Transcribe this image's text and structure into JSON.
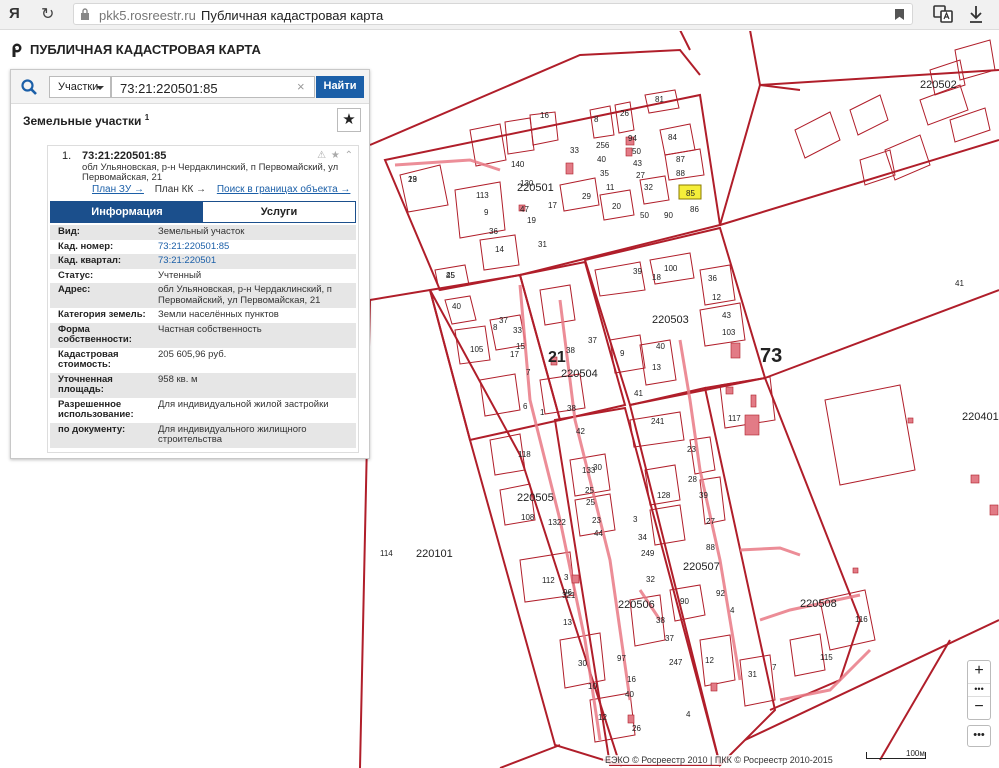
{
  "browser": {
    "logo": "Я",
    "domain": "pkk5.rosreestr.ru",
    "page_title": "Публичная кадастровая карта"
  },
  "app": {
    "title": "ПУБЛИЧНАЯ КАДАСТРОВАЯ КАРТА"
  },
  "search": {
    "type_label": "Участки",
    "query": "73:21:220501:85",
    "clear": "×",
    "find_label": "Найти"
  },
  "results": {
    "section_title": "Земельные участки",
    "count": "1",
    "item": {
      "num": "1.",
      "cad_number": "73:21:220501:85",
      "address_short": "обл Ульяновская, р-н Чердаклинский, п Первомайский, ул Первомайская, 21",
      "links": {
        "plan_zu": "План ЗУ →",
        "plan_kk": "План КК →",
        "search_bounds": "Поиск в границах объекта →"
      }
    },
    "tabs": {
      "info": "Информация",
      "services": "Услуги"
    },
    "properties": [
      {
        "k": "Вид:",
        "v": "Земельный участок",
        "link": false
      },
      {
        "k": "Кад. номер:",
        "v": "73:21:220501:85",
        "link": true
      },
      {
        "k": "Кад. квартал:",
        "v": "73:21:220501",
        "link": true
      },
      {
        "k": "Статус:",
        "v": "Учтенный",
        "link": false
      },
      {
        "k": "Адрес:",
        "v": "обл Ульяновская, р-н Чердаклинский, п Первомайский, ул Первомайская, 21",
        "link": false
      },
      {
        "k": "Категория земель:",
        "v": "Земли населённых пунктов",
        "link": false
      },
      {
        "k": "Форма собственности:",
        "v": "Частная собственность",
        "link": false
      },
      {
        "k": "Кадастровая стоимость:",
        "v": "205 605,96 руб.",
        "link": false
      },
      {
        "k": "Уточненная площадь:",
        "v": "958 кв. м",
        "link": false
      },
      {
        "k": "Разрешенное использование:",
        "v": "Для индивидуальной жилой застройки",
        "link": false
      },
      {
        "k": "по документу:",
        "v": "Для индивидуального жилищного строительства",
        "link": false
      }
    ]
  },
  "map": {
    "colors": {
      "boundary": "#b01e2a",
      "building": "#e27b86",
      "selected": "#f5ee3a",
      "road": "#e97a86"
    },
    "quarter_labels": [
      "220501",
      "220502",
      "220503",
      "220504",
      "220505",
      "220506",
      "220507",
      "220508",
      "220401",
      "220101",
      "73",
      "21",
      "41",
      "114",
      "117"
    ],
    "parcel_numbers": [
      "23",
      "16",
      "8",
      "26",
      "81",
      "84",
      "94",
      "50",
      "43",
      "27",
      "32",
      "87",
      "88",
      "85",
      "33",
      "256",
      "40",
      "35",
      "11",
      "140",
      "130",
      "47",
      "17",
      "29",
      "20",
      "113",
      "9",
      "36",
      "14",
      "19",
      "31",
      "45",
      "50",
      "90",
      "86",
      "25",
      "39",
      "100",
      "36",
      "18",
      "40",
      "12",
      "37",
      "33",
      "38",
      "105",
      "15",
      "7",
      "8",
      "17",
      "43",
      "103",
      "6",
      "1",
      "38",
      "42",
      "241",
      "23",
      "118",
      "37",
      "40",
      "9",
      "13",
      "41",
      "25",
      "28",
      "133",
      "25",
      "23",
      "30",
      "3",
      "34",
      "249",
      "128",
      "39",
      "27",
      "88",
      "92",
      "90",
      "4",
      "108",
      "1322",
      "96",
      "112",
      "3",
      "321",
      "13",
      "32",
      "38",
      "37",
      "44",
      "30",
      "10",
      "12",
      "97",
      "16",
      "40",
      "26",
      "247",
      "4",
      "31",
      "12",
      "7",
      "115",
      "116",
      "19"
    ],
    "zoom_in": "+",
    "zoom_dots": "•••",
    "zoom_out": "−",
    "more": "•••",
    "scale_label": "100м",
    "credits": "ЕЭКО © Росреестр 2010 | ПКК © Росреестр 2010-2015"
  }
}
